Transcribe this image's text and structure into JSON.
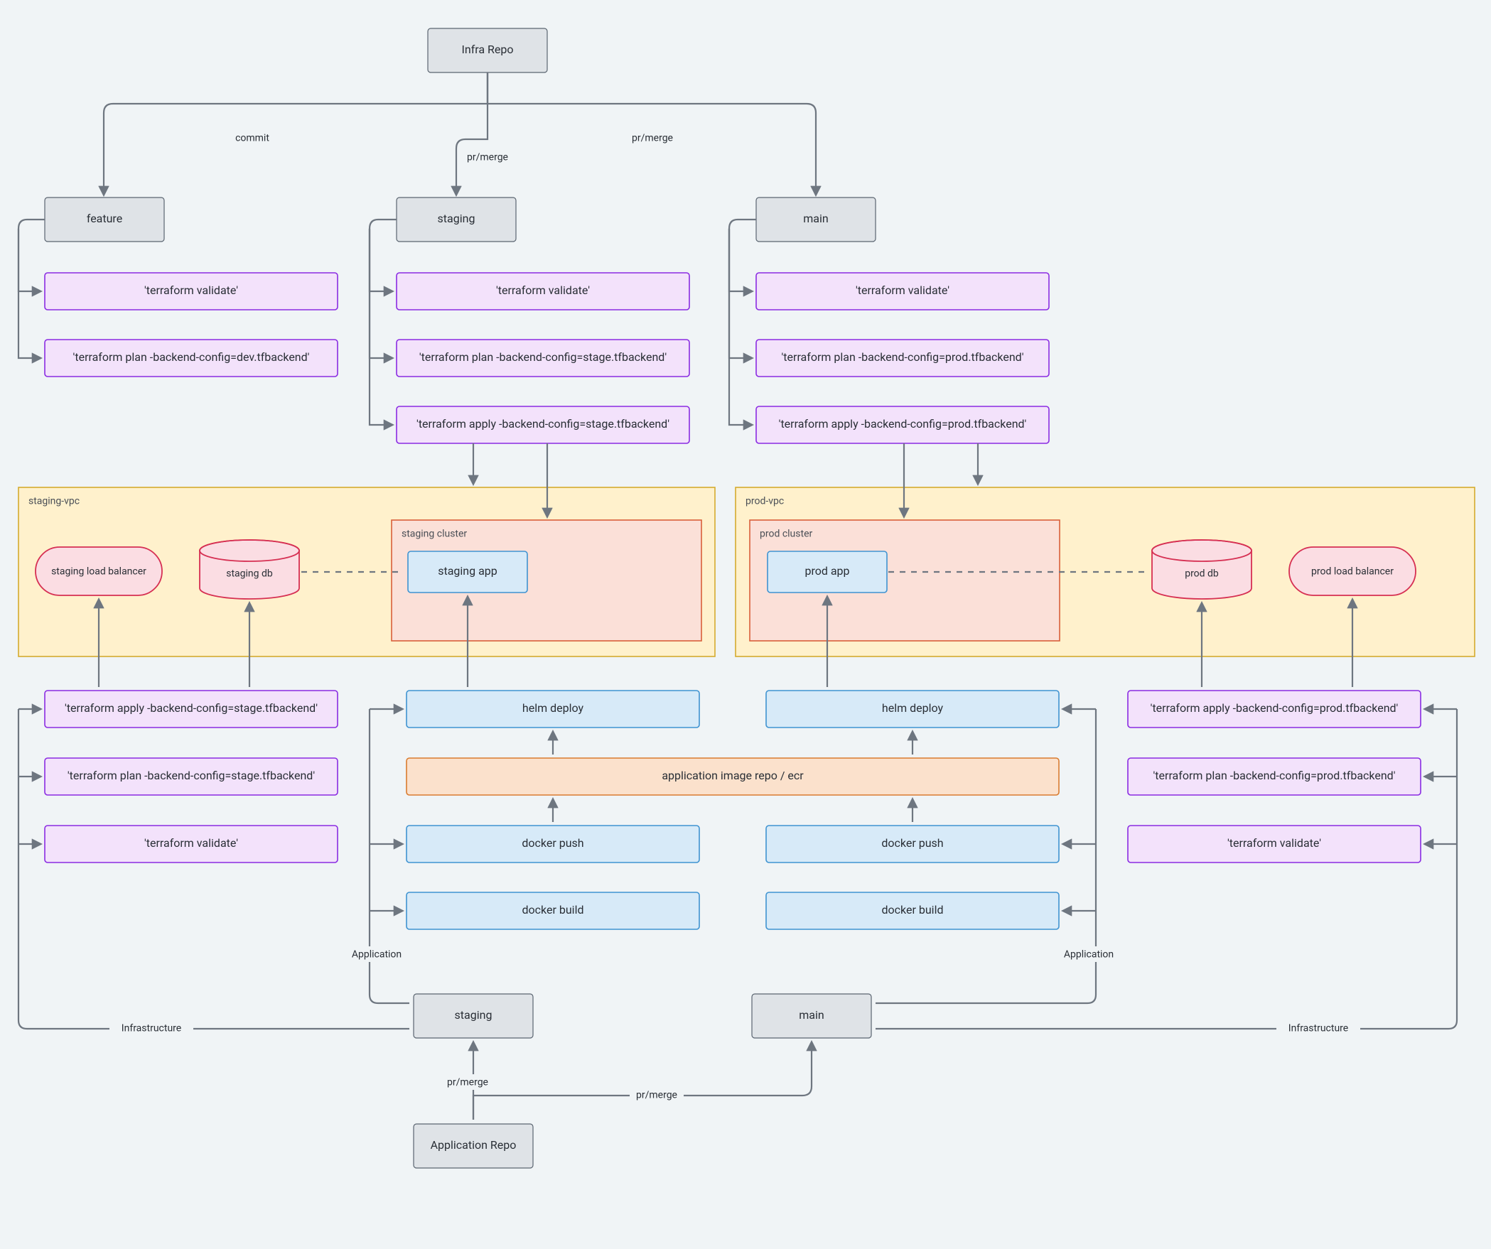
{
  "nodes": {
    "infra_repo": "Infra Repo",
    "feature": "feature",
    "staging": "staging",
    "main": "main",
    "tf_validate": "'terraform validate'",
    "tf_plan_dev": "'terraform plan -backend-config=dev.tfbackend'",
    "tf_plan_stage": "'terraform plan -backend-config=stage.tfbackend'",
    "tf_apply_stage": "'terraform apply -backend-config=stage.tfbackend'",
    "tf_plan_prod": "'terraform plan -backend-config=prod.tfbackend'",
    "tf_apply_prod": "'terraform apply -backend-config=prod.tfbackend'",
    "staging_vpc": "staging-vpc",
    "prod_vpc": "prod-vpc",
    "staging_cluster": "staging cluster",
    "prod_cluster": "prod cluster",
    "staging_app": "staging app",
    "prod_app": "prod app",
    "staging_lb": "staging load balancer",
    "prod_lb": "prod load balancer",
    "staging_db": "staging db",
    "prod_db": "prod db",
    "helm_deploy": "helm deploy",
    "docker_push": "docker push",
    "docker_build": "docker build",
    "image_repo": "application image repo / ecr",
    "app_staging_branch": "staging",
    "app_main_branch": "main",
    "application_repo": "Application Repo"
  },
  "edge_labels": {
    "commit": "commit",
    "pr_merge": "pr/merge",
    "application": "Application",
    "infrastructure": "Infrastructure"
  },
  "colors": {
    "bg": "#f0f4f6",
    "gray_fill": "#dfe3e7",
    "gray_stroke": "#5a6470",
    "purple_fill": "#f3e2fb",
    "purple_stroke": "#8a2be2",
    "blue_fill": "#d7eaf8",
    "blue_stroke": "#3f93d1",
    "orange_fill": "#fbe1cc",
    "orange_stroke": "#d97b2f",
    "vpc_fill": "#fff1cc",
    "vpc_stroke": "#d4ab2f",
    "cluster_fill": "#fbe0d8",
    "cluster_stroke": "#d95f3a",
    "red_fill": "#fbdde3",
    "red_stroke": "#d62f52",
    "edge": "#6e7680"
  }
}
